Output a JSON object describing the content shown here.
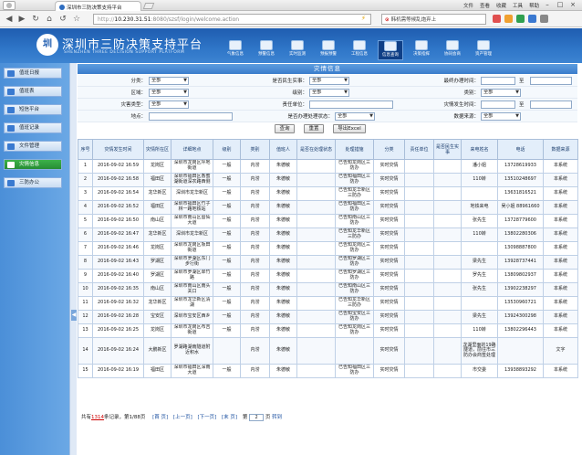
{
  "browser": {
    "tab_title": "深圳市三防决策支持平台",
    "url_prefix": "http://",
    "url_host": "10.230.31.51",
    "url_path": ":8080/szsf/login/welcome.action",
    "search_text": "韩机需等候乱炮弃上",
    "menu": [
      "文件",
      "查看",
      "收藏",
      "工具",
      "帮助"
    ]
  },
  "site": {
    "logo_text": "圳",
    "title": "深圳市三防决策支持平台",
    "subtitle": "SHENZHEN THREE DECISION SUPPORT PLATFORM",
    "topnav": [
      {
        "label": "气象信息"
      },
      {
        "label": "预警信息"
      },
      {
        "label": "实时监测"
      },
      {
        "label": "预报预警"
      },
      {
        "label": "工程信息"
      },
      {
        "label": "信息查询"
      },
      {
        "label": "决策指挥"
      },
      {
        "label": "协同会商"
      },
      {
        "label": "资产管理"
      }
    ]
  },
  "sidebar": {
    "items": [
      {
        "label": "值班日报"
      },
      {
        "label": "值班表"
      },
      {
        "label": "短信平台"
      },
      {
        "label": "值班记录"
      },
      {
        "label": "文件管理"
      },
      {
        "label": "灾情信息"
      },
      {
        "label": "三防办公"
      }
    ]
  },
  "filter": {
    "header": "灾情信息",
    "fields": {
      "fenlei_label": "分类：",
      "fenlei_value": "全部",
      "shifou_label": "是否民生实事：",
      "shifou_value": "全部",
      "shiyan_label": "最终办理时间：",
      "zhi": "至",
      "quyu_label": "区域：",
      "quyu_value": "全部",
      "jibie_label": "级别：",
      "jibie_value": "全部",
      "leibie_label": "类别：",
      "leibie_value": "全部",
      "zaiqing_label": "灾害类型：",
      "zaiqing_value": "全部",
      "zeren_label": "责任单位：",
      "fasheng_label": "灾情发生时间：",
      "didian_label": "地点：",
      "banli_label": "是否办理处理状态：",
      "banli_value": "全部",
      "laiyuan_label": "数据来源：",
      "laiyuan_value": "全部"
    },
    "buttons": {
      "query": "查询",
      "reset": "重置",
      "export": "导出Excel"
    }
  },
  "table": {
    "headers": [
      "序号",
      "灾情发生时间",
      "灾情所在区",
      "详细地点",
      "级别",
      "类别",
      "值班人",
      "是否在处理状态",
      "处理措施",
      "分类",
      "责任单位",
      "是否民生实事",
      "来电姓名",
      "电话",
      "数据来源"
    ],
    "rows": [
      [
        "1",
        "2016-09-02 16:59",
        "龙岗区",
        "深圳市龙岗区坪地街道",
        "一般",
        "内涝",
        "朱德敏",
        "",
        "已告知龙岗区三防办",
        "实时灾情",
        "",
        "",
        "潘小姐",
        "13728619933",
        "本系统"
      ],
      [
        "2",
        "2016-09-02 16:58",
        "福田区",
        "深圳市福田区香蜜湖街道深农路西侧",
        "一般",
        "内涝",
        "朱德敏",
        "",
        "已告知福田区三防办",
        "实时灾情",
        "",
        "",
        "110转",
        "13510248697",
        "本系统"
      ],
      [
        "3",
        "2016-09-02 16:54",
        "龙华新区",
        "深圳市龙华新区",
        "一般",
        "内涝",
        "朱德敏",
        "",
        "已告知龙华新区三防办",
        "实时灾情",
        "",
        "",
        "",
        "13631816521",
        "本系统"
      ],
      [
        "4",
        "2016-09-02 16:52",
        "福田区",
        "深圳市福田区竹子林一路地铁站",
        "一般",
        "内涝",
        "朱德敏",
        "",
        "已告知福田区三防办",
        "实时灾情",
        "",
        "",
        "地铁来电",
        "吴小姐 88961660",
        "本系统"
      ],
      [
        "5",
        "2016-09-02 16:50",
        "南山区",
        "深圳市南山区留仙大道",
        "一般",
        "内涝",
        "朱德敏",
        "",
        "已告知南山区三防办",
        "实时灾情",
        "",
        "",
        "张先生",
        "13728779600",
        "本系统"
      ],
      [
        "6",
        "2016-09-02 16:47",
        "龙华新区",
        "深圳市龙华新区",
        "一般",
        "内涝",
        "朱德敏",
        "",
        "已告知龙华新区三防办",
        "实时灾情",
        "",
        "",
        "110转",
        "13802280306",
        "本系统"
      ],
      [
        "7",
        "2016-09-02 16:46",
        "龙岗区",
        "深圳市龙岗区坂田街道",
        "一般",
        "内涝",
        "朱德敏",
        "",
        "已告知龙岗区三防办",
        "实时灾情",
        "",
        "",
        "",
        "13098887800",
        "本系统"
      ],
      [
        "8",
        "2016-09-02 16:43",
        "罗湖区",
        "深圳市罗湖区东门步行街",
        "一般",
        "内涝",
        "朱德敏",
        "",
        "已告知罗湖区三防办",
        "实时灾情",
        "",
        "",
        "梁先生",
        "13928737441",
        "本系统"
      ],
      [
        "9",
        "2016-09-02 16:40",
        "罗湖区",
        "深圳市罗湖区翠竹路",
        "一般",
        "内涝",
        "朱德敏",
        "",
        "已告知罗湖区三防办",
        "实时灾情",
        "",
        "",
        "罗先生",
        "13809802937",
        "本系统"
      ],
      [
        "10",
        "2016-09-02 16:35",
        "南山区",
        "深圳市南山区南头关口",
        "一般",
        "内涝",
        "朱德敏",
        "",
        "已告知南山区三防办",
        "实时灾情",
        "",
        "",
        "张先生",
        "13902238297",
        "本系统"
      ],
      [
        "11",
        "2016-09-02 16:32",
        "龙华新区",
        "深圳市龙华新区清湖",
        "一般",
        "内涝",
        "朱德敏",
        "",
        "已告知龙华新区三防办",
        "实时灾情",
        "",
        "",
        "",
        "13530960721",
        "本系统"
      ],
      [
        "12",
        "2016-09-02 16:28",
        "宝安区",
        "深圳市宝安区西乡",
        "一般",
        "内涝",
        "朱德敏",
        "",
        "已告知宝安区三防办",
        "实时灾情",
        "",
        "",
        "梁先生",
        "13924300298",
        "本系统"
      ],
      [
        "13",
        "2016-09-02 16:25",
        "龙岗区",
        "深圳市龙岗区布吉街道",
        "一般",
        "内涝",
        "朱德敏",
        "",
        "已告知龙岗区三防办",
        "实时灾情",
        "",
        "",
        "110转",
        "13802296443",
        "本系统"
      ],
      [
        "14",
        "2016-09-02 16:24",
        "大鹏新区",
        "罗湖路湖南隧道附近积水",
        "",
        "内涝",
        "朱德敏",
        "",
        "",
        "实时灾情",
        "",
        "",
        "龙湖里面的19路隧道，前往市三防办会商签处理",
        "",
        "文字"
      ],
      [
        "15",
        "2016-09-02 16:19",
        "福田区",
        "深圳市福田区深南大道",
        "一般",
        "内涝",
        "朱德敏",
        "",
        "已告知福田区三防办",
        "实时灾情",
        "",
        "",
        "市交委",
        "13938893292",
        "本系统"
      ]
    ]
  },
  "pager": {
    "total_prefix": "共有",
    "total": "1314",
    "total_suffix": "条记录，第1/88页",
    "first": "[首 页]",
    "prev": "[上一页]",
    "next": "[下一页]",
    "last": "[末 页]",
    "goto_prefix": "第",
    "goto_value": "2",
    "goto_suffix": "页",
    "go": "转到"
  }
}
